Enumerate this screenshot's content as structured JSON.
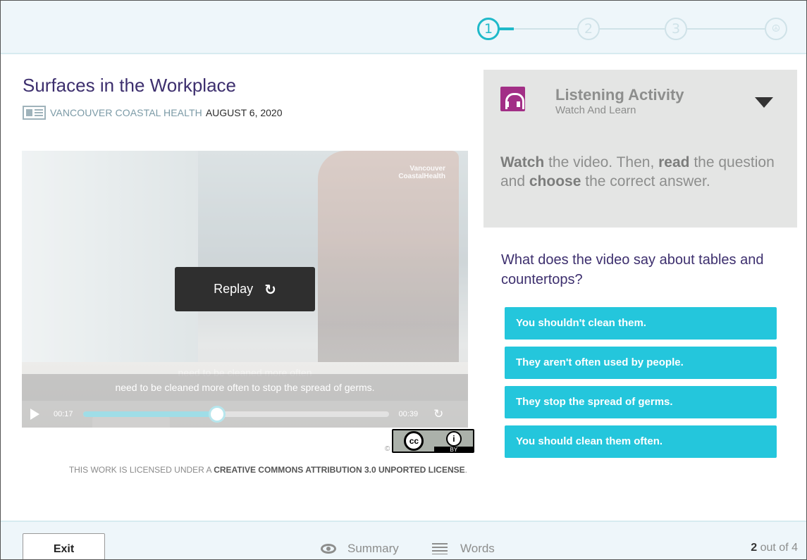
{
  "stepper": {
    "steps": [
      "1",
      "2",
      "3",
      "☮"
    ],
    "current_step": 1
  },
  "article": {
    "title": "Surfaces in the Workplace",
    "source": "VANCOUVER COASTAL HEALTH",
    "date": "AUGUST 6, 2020"
  },
  "video": {
    "watermark_line1": "Vancouver",
    "watermark_line2": "CoastalHealth",
    "replay_label": "Replay",
    "caption_ghost": "need to be cleaned more often",
    "caption": "need to be cleaned more often to stop the spread of germs.",
    "current_time": "00:17",
    "duration": "00:39",
    "progress_fraction": 0.44
  },
  "license": {
    "copyright_symbol": "©",
    "cc_label": "cc",
    "by_icon": "i",
    "by_label": "BY",
    "prefix": "THIS WORK IS LICENSED UNDER A ",
    "bold": "CREATIVE COMMONS ATTRIBUTION 3.0 UNPORTED LICENSE",
    "suffix": "."
  },
  "activity": {
    "icon": "headphones-icon",
    "icon_color": "#a22f86",
    "title": "Listening Activity",
    "subtitle": "Watch And Learn",
    "instr_w1": "Watch",
    "instr_t1": " the video. Then, ",
    "instr_w2": "read",
    "instr_t2": " the question and ",
    "instr_w3": "choose",
    "instr_t3": " the correct answer."
  },
  "question": {
    "text": "What does the video say about tables and countertops?",
    "answers": [
      "You shouldn't clean them.",
      "They aren't often used by people.",
      "They stop the spread of germs.",
      "You should clean them often."
    ],
    "answer_color": "#24c6dc"
  },
  "footer": {
    "exit_label": "Exit",
    "summary_label": "Summary",
    "words_label": "Words",
    "progress_current": "2",
    "progress_text": " out of 4"
  },
  "colors": {
    "accent": "#1fb9c9",
    "title": "#3d2f6e"
  }
}
